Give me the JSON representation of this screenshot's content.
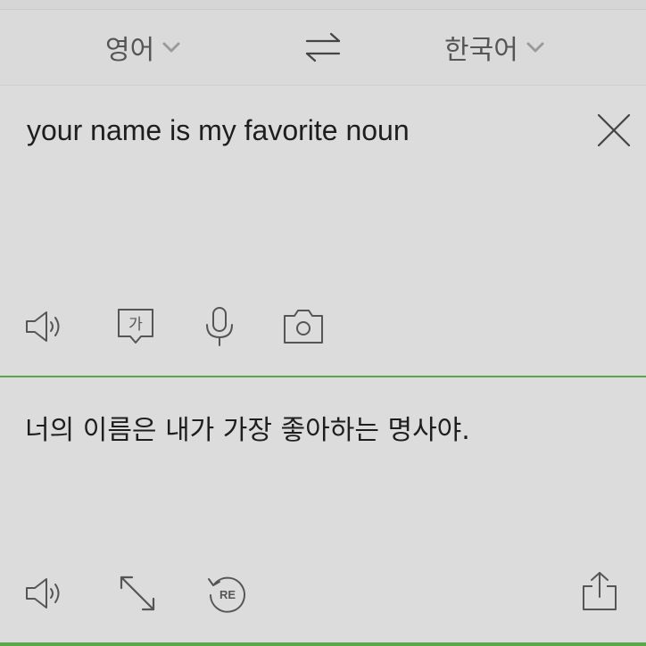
{
  "language_bar": {
    "source_language": "영어",
    "target_language": "한국어"
  },
  "input": {
    "text": "your name is my favorite noun"
  },
  "output": {
    "text": "너의 이름은 내가 가장 좋아하는 명사야."
  },
  "input_toolbar": {
    "icons": [
      "speaker-icon",
      "honorific-icon",
      "microphone-icon",
      "camera-icon"
    ],
    "honorific_glyph": "가"
  },
  "output_toolbar": {
    "icons": [
      "speaker-icon",
      "expand-icon",
      "retranslate-icon",
      "share-icon"
    ],
    "retranslate_glyph": "RE"
  },
  "colors": {
    "accent_green": "#5ba84a",
    "background": "#dcdcdc",
    "icon_gray": "#555555"
  }
}
